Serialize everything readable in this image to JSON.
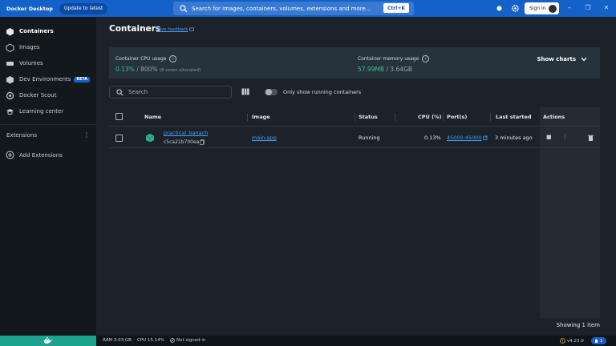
{
  "titlebar": {
    "app_title": "Docker Desktop",
    "update_label": "Update to latest",
    "search_placeholder": "Search for images, containers, volumes, extensions and more...",
    "shortcut": "Ctrl+K",
    "signin_label": "Sign in"
  },
  "sidebar": {
    "items": [
      {
        "label": "Containers",
        "icon": "containers-icon"
      },
      {
        "label": "Images",
        "icon": "images-icon"
      },
      {
        "label": "Volumes",
        "icon": "volumes-icon"
      },
      {
        "label": "Dev Environments",
        "icon": "dev-environments-icon",
        "badge": "BETA"
      },
      {
        "label": "Docker Scout",
        "icon": "docker-scout-icon"
      },
      {
        "label": "Learning center",
        "icon": "learning-center-icon"
      }
    ],
    "extensions_label": "Extensions",
    "add_extensions_label": "Add Extensions"
  },
  "main": {
    "title": "Containers",
    "feedback_label": "Give feedback",
    "stats": {
      "cpu_label": "Container CPU usage",
      "cpu_value": "0.13%",
      "cpu_total": "/ 800%",
      "cpu_note": "(8 cores allocated)",
      "mem_label": "Container memory usage",
      "mem_value": "57.99MB",
      "mem_total": "/ 3.64GB",
      "show_charts_label": "Show charts"
    },
    "search_placeholder": "Search",
    "toggle_label": "Only show running containers",
    "columns": [
      "Name",
      "Image",
      "Status",
      "CPU (%)",
      "Port(s)",
      "Last started",
      "Actions"
    ],
    "rows": [
      {
        "name": "practical_banach",
        "id": "c5ca21b700ea",
        "image": "main-app",
        "status": "Running",
        "cpu": "0.13%",
        "ports": "45000:45000",
        "last_started": "3 minutes ago"
      }
    ],
    "showing": "Showing 1 item"
  },
  "statusbar": {
    "ram": "RAM 3.03 GB",
    "cpu": "CPU 15.14%",
    "signin_status": "Not signed in",
    "version": "v4.23.0",
    "notifications": "1"
  },
  "colors": {
    "titlebar": "#1462c7",
    "accent_green": "#3fbf8a",
    "link": "#4a9df8",
    "whale_bar": "#1aa38d"
  }
}
